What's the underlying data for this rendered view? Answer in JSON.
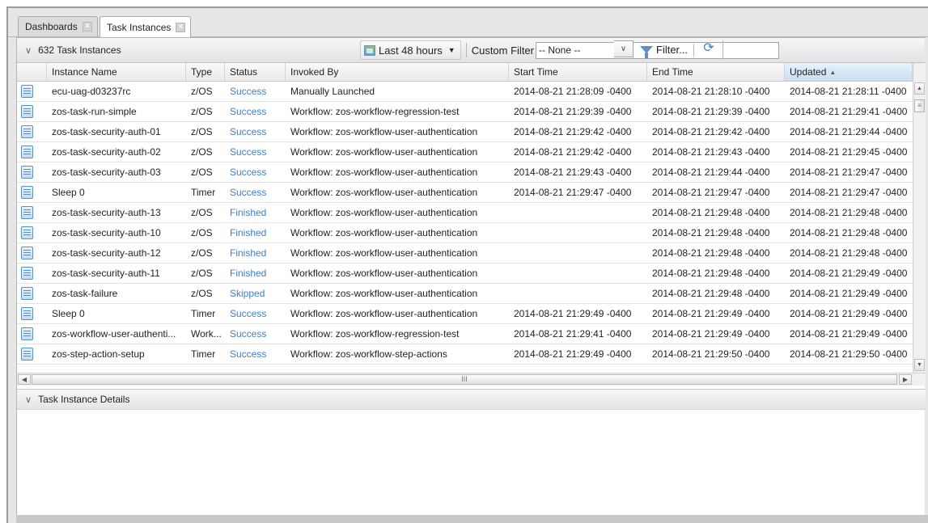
{
  "tabs": [
    {
      "label": "Dashboards",
      "active": false
    },
    {
      "label": "Task Instances",
      "active": true
    }
  ],
  "toolbar": {
    "title": "632 Task Instances",
    "date_range": "Last 48 hours",
    "custom_filter_label": "Custom Filter",
    "custom_filter_value": "-- None --",
    "filter_label": "Filter..."
  },
  "grid": {
    "columns": [
      "Instance Name",
      "Type",
      "Status",
      "Invoked By",
      "Start Time",
      "End Time",
      "Updated"
    ],
    "sorted_column": "Updated",
    "rows": [
      {
        "name": "ecu-uag-d03237rc",
        "type": "z/OS",
        "status": "Success",
        "invoked_by": "Manually Launched",
        "start": "2014-08-21 21:28:09 -0400",
        "end": "2014-08-21 21:28:10 -0400",
        "updated": "2014-08-21 21:28:11 -0400"
      },
      {
        "name": "zos-task-run-simple",
        "type": "z/OS",
        "status": "Success",
        "invoked_by": "Workflow: zos-workflow-regression-test",
        "start": "2014-08-21 21:29:39 -0400",
        "end": "2014-08-21 21:29:39 -0400",
        "updated": "2014-08-21 21:29:41 -0400"
      },
      {
        "name": "zos-task-security-auth-01",
        "type": "z/OS",
        "status": "Success",
        "invoked_by": "Workflow: zos-workflow-user-authentication",
        "start": "2014-08-21 21:29:42 -0400",
        "end": "2014-08-21 21:29:42 -0400",
        "updated": "2014-08-21 21:29:44 -0400"
      },
      {
        "name": "zos-task-security-auth-02",
        "type": "z/OS",
        "status": "Success",
        "invoked_by": "Workflow: zos-workflow-user-authentication",
        "start": "2014-08-21 21:29:42 -0400",
        "end": "2014-08-21 21:29:43 -0400",
        "updated": "2014-08-21 21:29:45 -0400"
      },
      {
        "name": "zos-task-security-auth-03",
        "type": "z/OS",
        "status": "Success",
        "invoked_by": "Workflow: zos-workflow-user-authentication",
        "start": "2014-08-21 21:29:43 -0400",
        "end": "2014-08-21 21:29:44 -0400",
        "updated": "2014-08-21 21:29:47 -0400"
      },
      {
        "name": "Sleep 0",
        "type": "Timer",
        "status": "Success",
        "invoked_by": "Workflow: zos-workflow-user-authentication",
        "start": "2014-08-21 21:29:47 -0400",
        "end": "2014-08-21 21:29:47 -0400",
        "updated": "2014-08-21 21:29:47 -0400"
      },
      {
        "name": "zos-task-security-auth-13",
        "type": "z/OS",
        "status": "Finished",
        "invoked_by": "Workflow: zos-workflow-user-authentication",
        "start": "",
        "end": "2014-08-21 21:29:48 -0400",
        "updated": "2014-08-21 21:29:48 -0400"
      },
      {
        "name": "zos-task-security-auth-10",
        "type": "z/OS",
        "status": "Finished",
        "invoked_by": "Workflow: zos-workflow-user-authentication",
        "start": "",
        "end": "2014-08-21 21:29:48 -0400",
        "updated": "2014-08-21 21:29:48 -0400"
      },
      {
        "name": "zos-task-security-auth-12",
        "type": "z/OS",
        "status": "Finished",
        "invoked_by": "Workflow: zos-workflow-user-authentication",
        "start": "",
        "end": "2014-08-21 21:29:48 -0400",
        "updated": "2014-08-21 21:29:48 -0400"
      },
      {
        "name": "zos-task-security-auth-11",
        "type": "z/OS",
        "status": "Finished",
        "invoked_by": "Workflow: zos-workflow-user-authentication",
        "start": "",
        "end": "2014-08-21 21:29:48 -0400",
        "updated": "2014-08-21 21:29:49 -0400"
      },
      {
        "name": "zos-task-failure",
        "type": "z/OS",
        "status": "Skipped",
        "invoked_by": "Workflow: zos-workflow-user-authentication",
        "start": "",
        "end": "2014-08-21 21:29:48 -0400",
        "updated": "2014-08-21 21:29:49 -0400"
      },
      {
        "name": "Sleep 0",
        "type": "Timer",
        "status": "Success",
        "invoked_by": "Workflow: zos-workflow-user-authentication",
        "start": "2014-08-21 21:29:49 -0400",
        "end": "2014-08-21 21:29:49 -0400",
        "updated": "2014-08-21 21:29:49 -0400"
      },
      {
        "name": "zos-workflow-user-authenti...",
        "type": "Work...",
        "status": "Success",
        "invoked_by": "Workflow: zos-workflow-regression-test",
        "start": "2014-08-21 21:29:41 -0400",
        "end": "2014-08-21 21:29:49 -0400",
        "updated": "2014-08-21 21:29:49 -0400"
      },
      {
        "name": "zos-step-action-setup",
        "type": "Timer",
        "status": "Success",
        "invoked_by": "Workflow: zos-workflow-step-actions",
        "start": "2014-08-21 21:29:49 -0400",
        "end": "2014-08-21 21:29:50 -0400",
        "updated": "2014-08-21 21:29:50 -0400"
      }
    ]
  },
  "details": {
    "title": "Task Instance Details"
  },
  "colors": {
    "status_link": "#3b7fd0",
    "sorted_header": "#c9def2"
  }
}
